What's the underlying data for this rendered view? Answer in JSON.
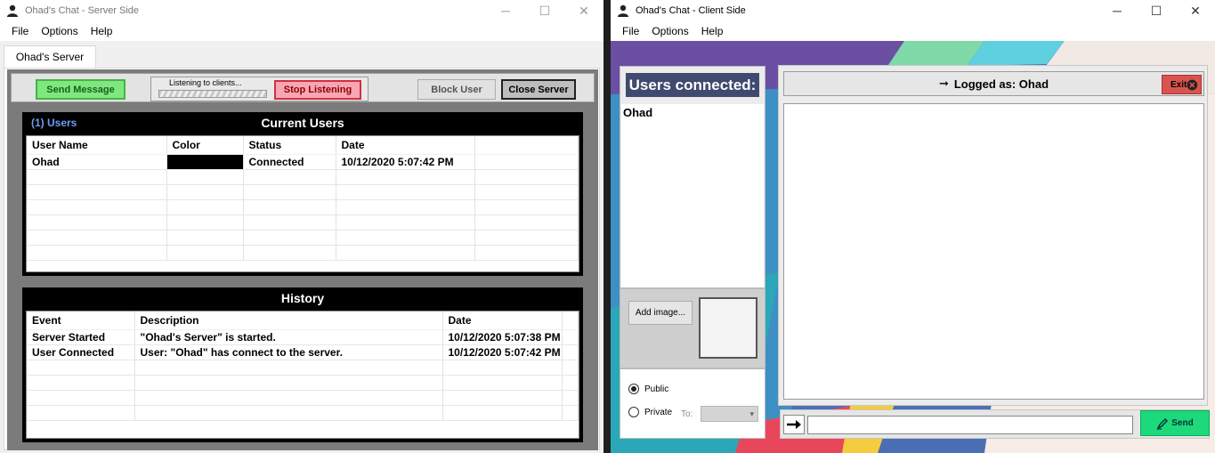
{
  "server": {
    "title": "Ohad's Chat - Server Side",
    "menu": [
      "File",
      "Options",
      "Help"
    ],
    "tab": "Ohad's Server",
    "toolbar": {
      "send_message": "Send Message",
      "listening_label": "Listening to clients...",
      "stop_listening": "Stop Listening",
      "block_user": "Block User",
      "close_server": "Close Server"
    },
    "users": {
      "count_label": "(1) Users",
      "title": "Current Users",
      "columns": [
        "User Name",
        "Color",
        "Status",
        "Date"
      ],
      "rows": [
        {
          "name": "Ohad",
          "color": "#000000",
          "status": "Connected",
          "date": "10/12/2020 5:07:42 PM"
        }
      ]
    },
    "history": {
      "title": "History",
      "columns": [
        "Event",
        "Description",
        "Date"
      ],
      "rows": [
        {
          "event": "Server Started",
          "description": "\"Ohad's Server\" is started.",
          "date": "10/12/2020 5:07:38 PM"
        },
        {
          "event": "User Connected",
          "description": "User: \"Ohad\" has connect to the server.",
          "date": "10/12/2020 5:07:42 PM"
        }
      ]
    }
  },
  "client": {
    "title": "Ohad's Chat - Client Side",
    "menu": [
      "File",
      "Options",
      "Help"
    ],
    "users_header": "Users connected:",
    "users": [
      "Ohad"
    ],
    "add_image": "Add image...",
    "visibility": {
      "public": "Public",
      "private": "Private",
      "to_label": "To:",
      "selected": "public"
    },
    "logged_as": "Logged as: Ohad",
    "logged_arrow": "➞",
    "exit": "Exit",
    "send": "Send",
    "message_value": ""
  },
  "window_controls": {
    "minimize": "─",
    "maximize": "☐",
    "close": "✕"
  },
  "colors": {
    "send_green": "#7ee87e",
    "stop_red": "#f8a6b4",
    "users_header_bg": "#3f4a6e",
    "client_send": "#1ed97b",
    "exit_red": "#d9534f"
  }
}
